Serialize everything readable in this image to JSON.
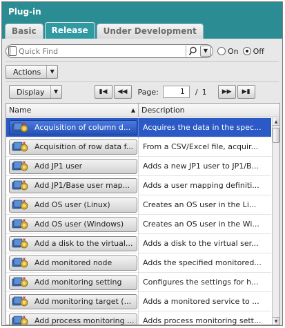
{
  "window": {
    "title": "Plug-in"
  },
  "tabs": [
    {
      "label": "Basic",
      "active": false
    },
    {
      "label": "Release",
      "active": true
    },
    {
      "label": "Under Development",
      "active": false
    }
  ],
  "search": {
    "placeholder": "Quick Find",
    "value": ""
  },
  "filter_toggle": {
    "on_label": "On",
    "off_label": "Off",
    "selected": "Off"
  },
  "actions": {
    "label": "Actions"
  },
  "pager": {
    "display_label": "Display",
    "page_label": "Page:",
    "current_page": "1",
    "separator": "/",
    "total_pages": "1"
  },
  "table": {
    "columns": {
      "name": "Name",
      "description": "Description"
    },
    "sort": {
      "column": "Name",
      "direction": "ascending"
    },
    "selected_row": 0,
    "rows": [
      {
        "name": "Acquisition of column d...",
        "description": "Acquires the data in the spec..."
      },
      {
        "name": "Acquisition of row data f...",
        "description": "From a CSV/Excel file, acquir..."
      },
      {
        "name": "Add JP1 user",
        "description": "Adds a new JP1 user to JP1/B..."
      },
      {
        "name": "Add JP1/Base user map...",
        "description": "Adds a user mapping definiti..."
      },
      {
        "name": "Add OS user (Linux)",
        "description": "Creates an OS user in the Li..."
      },
      {
        "name": "Add OS user (Windows)",
        "description": "Creates an OS user in the Wi..."
      },
      {
        "name": "Add a disk to the virtual...",
        "description": "Adds a disk to the virtual ser..."
      },
      {
        "name": "Add monitored node",
        "description": "Adds the specified monitored..."
      },
      {
        "name": "Add monitoring setting",
        "description": "Configures the settings for h..."
      },
      {
        "name": "Add monitoring target (...",
        "description": "Adds a monitored service to ..."
      },
      {
        "name": "Add process monitoring ...",
        "description": "Adds process monitoring sett..."
      }
    ]
  },
  "colors": {
    "header_teal": "#2c8c93",
    "active_tab": "#2f9aa2",
    "selection_blue": "#2b59c6"
  }
}
